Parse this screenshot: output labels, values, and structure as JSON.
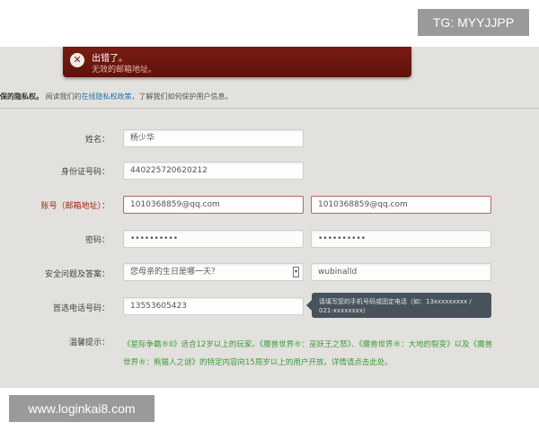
{
  "watermarks": {
    "top_right": "TG: MYYJJPP",
    "bottom_left": "www.loginkai8.com"
  },
  "error": {
    "icon": "close-icon",
    "title": "出错了。",
    "message": "无效的邮箱地址。"
  },
  "privacy": {
    "lead": "保的隐私权。",
    "before_link": "阅读我们的",
    "link": "在线隐私权政策",
    "after_link": "，了解我们如何保护用户信息。"
  },
  "form": {
    "name": {
      "label": "姓名：",
      "value": "杨少华"
    },
    "id_number": {
      "label": "身份证号码：",
      "value": "440225720620212"
    },
    "account": {
      "label": "账号（邮箱地址）：",
      "value": "1010368859@qq.com",
      "confirm_value": "1010368859@qq.com"
    },
    "password": {
      "label": "密码：",
      "value": "••••••••••",
      "confirm_value": "••••••••••"
    },
    "security": {
      "label": "安全问题及答案：",
      "question": "您母亲的生日是哪一天？",
      "answer": "wubinalld"
    },
    "phone": {
      "label": "首选电话号码：",
      "value": "13553605423"
    },
    "phone_tip": "请填写您的手机号码或固定电话（如：13xxxxxxxxx / 021-xxxxxxxx）",
    "notice": {
      "label": "温馨提示：",
      "text": "《星际争霸®II》适合12岁以上的玩家。《魔兽世界®：巫妖王之怒》、《魔兽世界®：大地的裂变》以及《魔兽世界®：熊猫人之谜》的特定内容向15周岁以上的用户开放。详情请点击此处。"
    }
  },
  "colors": {
    "error_banner": "#6b160d",
    "label_error": "#a6281c",
    "link": "#1d76b3",
    "notice_text": "#3c9b3c",
    "tooltip_bg": "#48525b"
  }
}
